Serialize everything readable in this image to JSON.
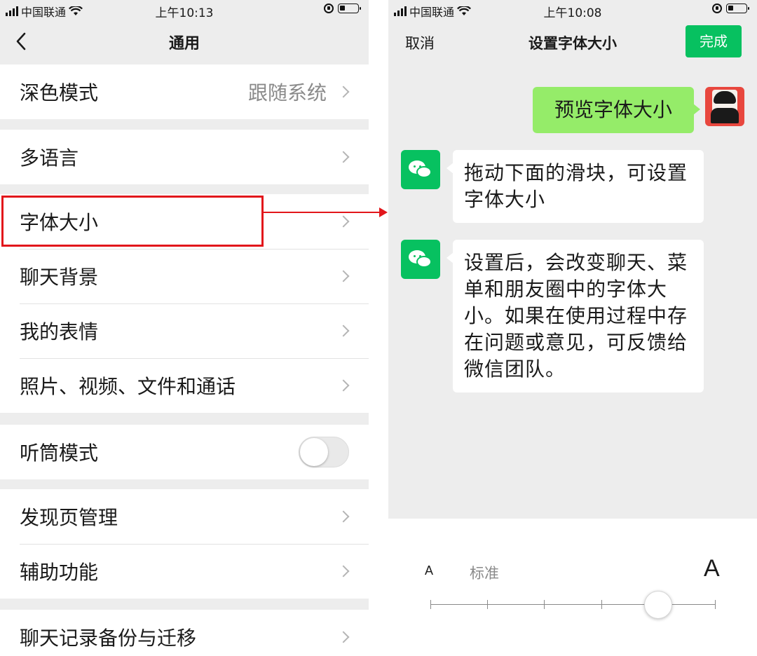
{
  "left": {
    "status": {
      "carrier": "中国联通",
      "time": "上午10:13"
    },
    "nav": {
      "title": "通用"
    },
    "settings": [
      {
        "label": "深色模式",
        "value": "跟随系统"
      },
      {
        "label": "多语言"
      },
      {
        "label": "字体大小"
      },
      {
        "label": "聊天背景"
      },
      {
        "label": "我的表情"
      },
      {
        "label": "照片、视频、文件和通话"
      },
      {
        "label": "听筒模式",
        "toggle": false
      },
      {
        "label": "发现页管理"
      },
      {
        "label": "辅助功能"
      },
      {
        "label": "聊天记录备份与迁移"
      }
    ]
  },
  "right": {
    "status": {
      "carrier": "中国联通",
      "time": "上午10:08"
    },
    "nav": {
      "cancel": "取消",
      "title": "设置字体大小",
      "done": "完成"
    },
    "messages": {
      "self": "预览字体大小",
      "bot1": "拖动下面的滑块，可设置字体大小",
      "bot2": "设置后，会改变聊天、菜单和朋友圈中的字体大小。如果在使用过程中存在问题或意见，可反馈给微信团队。"
    },
    "slider": {
      "small_label": "A",
      "standard_label": "标准",
      "large_label": "A",
      "levels": 6,
      "selected_index": 4
    }
  },
  "colors": {
    "accent_green": "#07c160",
    "bubble_green": "#95ec69",
    "highlight_red": "#e2161b"
  },
  "icons": [
    "back-chevron-icon",
    "wifi-icon",
    "signal-icon",
    "battery-icon",
    "rotation-lock-icon",
    "chevron-right-icon",
    "wechat-icon"
  ]
}
